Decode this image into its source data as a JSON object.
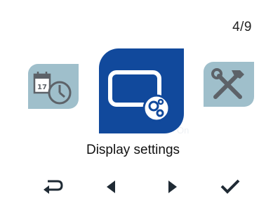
{
  "screen": {
    "page_counter": "4/9",
    "state_hint": "On",
    "title": "Display settings"
  },
  "menu": {
    "items": [
      {
        "name": "calendar-clock",
        "icon": "calendar-clock-icon",
        "selected": false
      },
      {
        "name": "display-settings",
        "icon": "display-settings-icon",
        "selected": true
      },
      {
        "name": "tools",
        "icon": "tools-icon",
        "selected": false
      }
    ]
  },
  "nav": {
    "back_icon": "back-arrow-icon",
    "prev_icon": "triangle-left-icon",
    "next_icon": "triangle-right-icon",
    "confirm_icon": "checkmark-icon"
  },
  "colors": {
    "selected_tile": "#11499c",
    "inactive_tile": "#9fbfcb",
    "icon_gray": "#5d6268",
    "nav_icon": "#1f2a34"
  }
}
